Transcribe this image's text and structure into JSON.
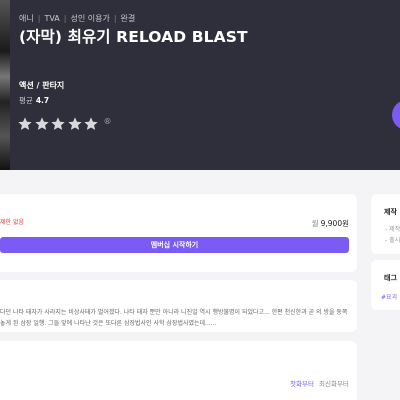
{
  "hero": {
    "meta": [
      "애니",
      "TVA",
      "성인 이용가",
      "완결"
    ],
    "title": "(자막) 최유기 RELOAD BLAST",
    "genre": "액션 / 판타지",
    "rating_label": "평균",
    "rating_value": "4.7",
    "star_count": 5,
    "info_icon": "®"
  },
  "purchase": {
    "limited_text": "제한 없음",
    "price_currency": "월",
    "price": "9,900원",
    "button_label": "멤버십 시작하기"
  },
  "synopsis": {
    "text": "다던 나타 태자가 사라지는 비상사태가 벌어졌다. 나타 태자 뿐만 아니라 니진일 역시 행방불명이 되었다고... 한편 천신한과 곧 의 방을 동쪽 놓게 된 삼장 일행. 그들 앞에 나타난 것은 또다른 삼장법사인 사학 삼장법사였는데......"
  },
  "episodes": {
    "sort_first": "첫화부터",
    "sort_latest": "최신화부터"
  },
  "sidebar": {
    "production_title": "제작",
    "production_lines": [
      "제작",
      "출시"
    ],
    "tags_title": "태그",
    "tag": "#요괴"
  },
  "colors": {
    "accent": "#7a5cf5",
    "hero_bg": "#2f2f3b",
    "warning": "#e23b3b",
    "page_bg": "#f4f4f6"
  }
}
